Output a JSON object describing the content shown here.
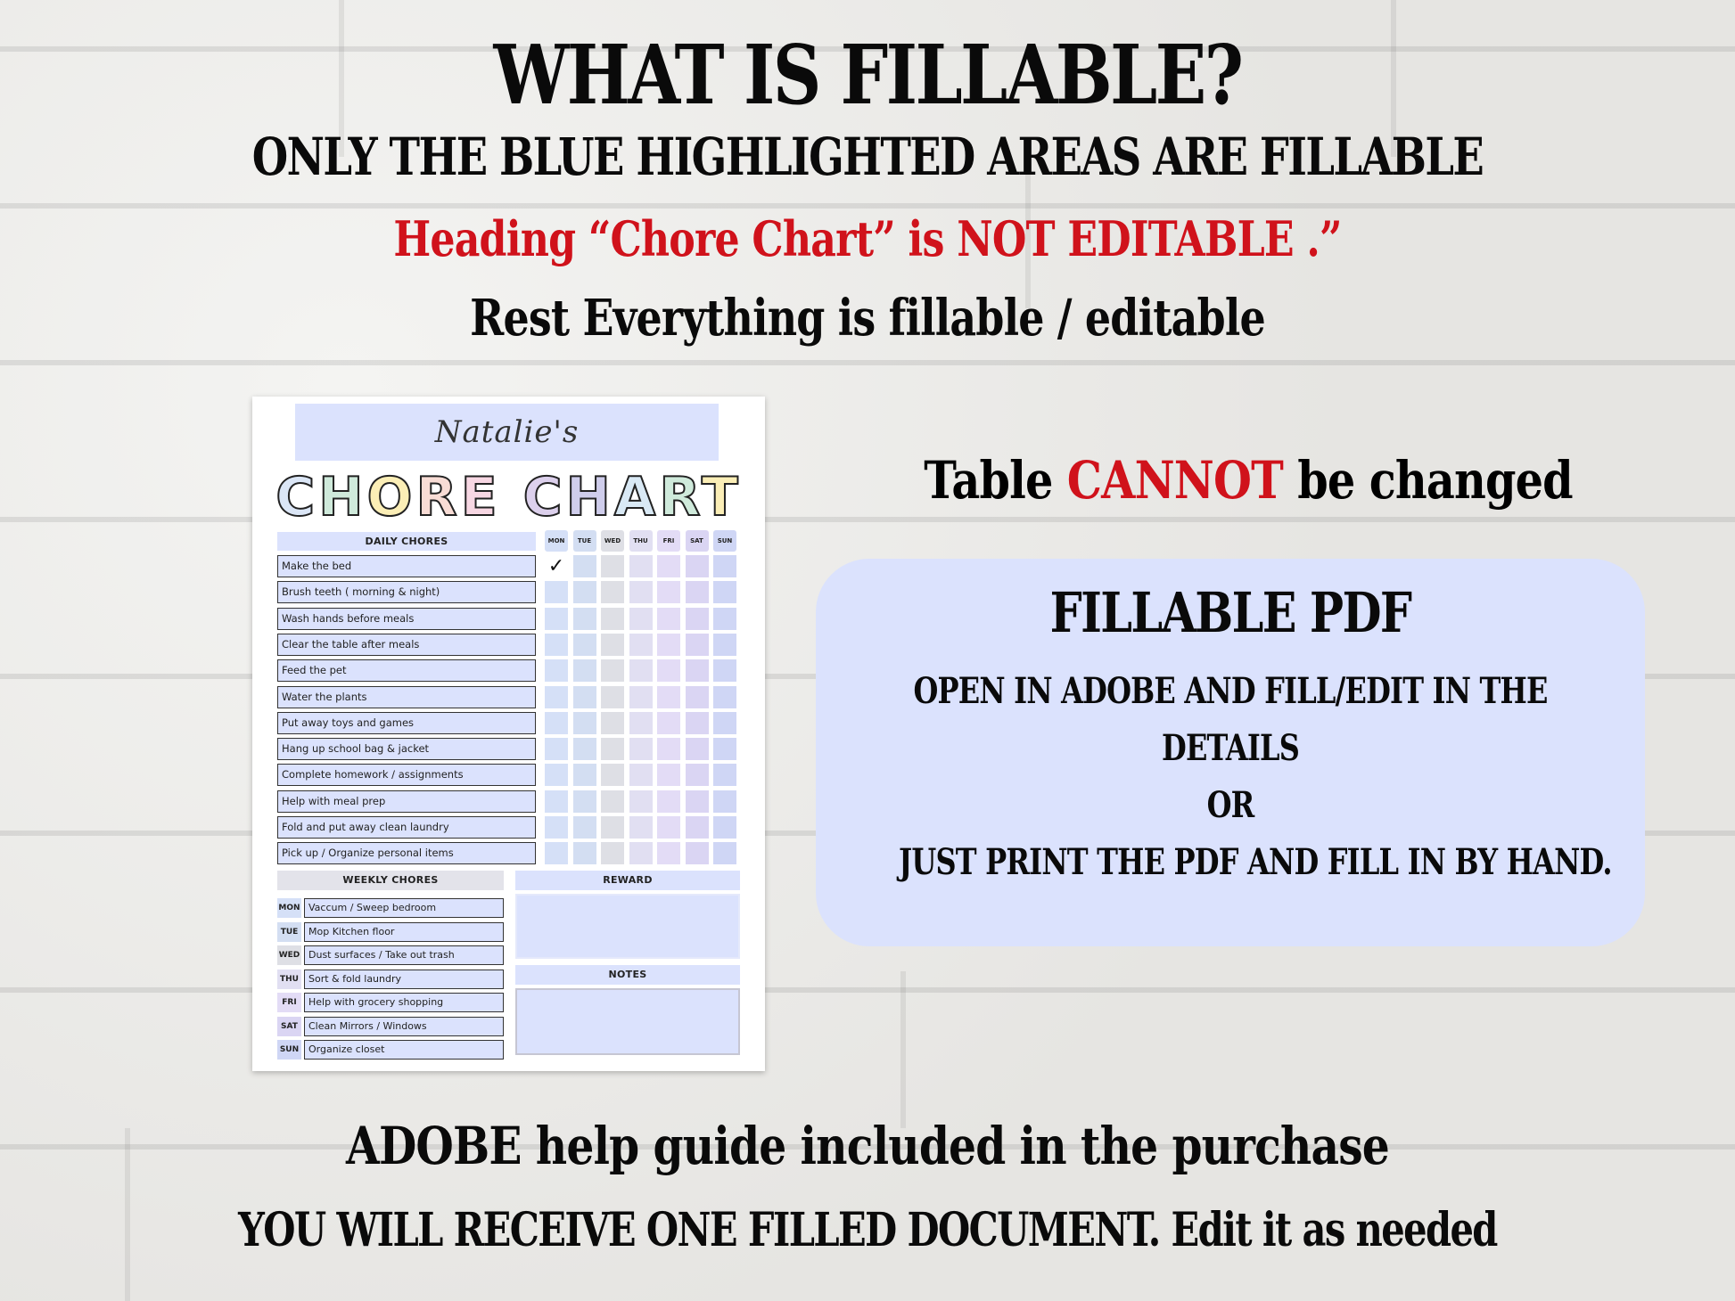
{
  "headline": {
    "title": "WHAT IS FILLABLE?",
    "subtitle": "ONLY THE BLUE HIGHLIGHTED AREAS ARE FILLABLE",
    "warning": "Heading “Chore Chart” is NOT EDITABLE .”",
    "rest": "Rest Everything is fillable / editable"
  },
  "table_note": {
    "prefix": "Table ",
    "highlight": "CANNOT",
    "suffix": " be changed"
  },
  "info_card": {
    "title": "FILLABLE PDF",
    "lines": [
      "OPEN IN ADOBE AND FILL/EDIT IN THE",
      "DETAILS",
      "OR",
      "JUST PRINT THE PDF AND FILL IN BY HAND."
    ]
  },
  "footer": {
    "line1": "ADOBE help guide included in the purchase",
    "line2": "YOU WILL RECEIVE ONE FILLED DOCUMENT. Edit it as needed"
  },
  "colors": {
    "accent_red": "#d0121b",
    "fillable_blue": "#dbe2fd",
    "text_black": "#0a0a0a"
  },
  "chore_chart": {
    "name": "Natalie's",
    "heading": "CHORE CHART",
    "heading_letter_colors": [
      "#dbe6f6",
      "#cfeadb",
      "#fbeeb6",
      "#f8dcd5",
      "#f7d7e3",
      "#ffffff",
      "#dcd0ec",
      "#cfcdeb",
      "#d9e9f5",
      "#cfeadb",
      "#fbeeb6"
    ],
    "daily_header": "DAILY CHORES",
    "days": [
      "MON",
      "TUE",
      "WED",
      "THU",
      "FRI",
      "SAT",
      "SUN"
    ],
    "day_colors": [
      "#d5e0f7",
      "#d3def2",
      "#dedfe5",
      "#e1dff2",
      "#e3dcf6",
      "#dad5f3",
      "#cfd6f5"
    ],
    "daily_chores": [
      "Make the bed",
      "Brush teeth ( morning & night)",
      "Wash hands before meals",
      "Clear the table after meals",
      "Feed the pet",
      "Water the plants",
      "Put away toys and games",
      "Hang up school bag & jacket",
      "Complete homework / assignments",
      "Help with meal prep",
      "Fold and put away clean laundry",
      "Pick up / Organize personal items"
    ],
    "checked": [
      {
        "row": 0,
        "day": "MON",
        "mark": "✓"
      }
    ],
    "weekly_header": "WEEKLY CHORES",
    "weekly_chores": [
      {
        "day": "MON",
        "chore": "Vaccum / Sweep bedroom"
      },
      {
        "day": "TUE",
        "chore": "Mop Kitchen floor"
      },
      {
        "day": "WED",
        "chore": "Dust surfaces / Take out trash"
      },
      {
        "day": "THU",
        "chore": "Sort & fold laundry"
      },
      {
        "day": "FRI",
        "chore": "Help with grocery shopping"
      },
      {
        "day": "SAT",
        "chore": "Clean Mirrors / Windows"
      },
      {
        "day": "SUN",
        "chore": "Organize closet"
      }
    ],
    "reward_header": "REWARD",
    "reward_value": "",
    "notes_header": "NOTES",
    "notes_value": ""
  }
}
